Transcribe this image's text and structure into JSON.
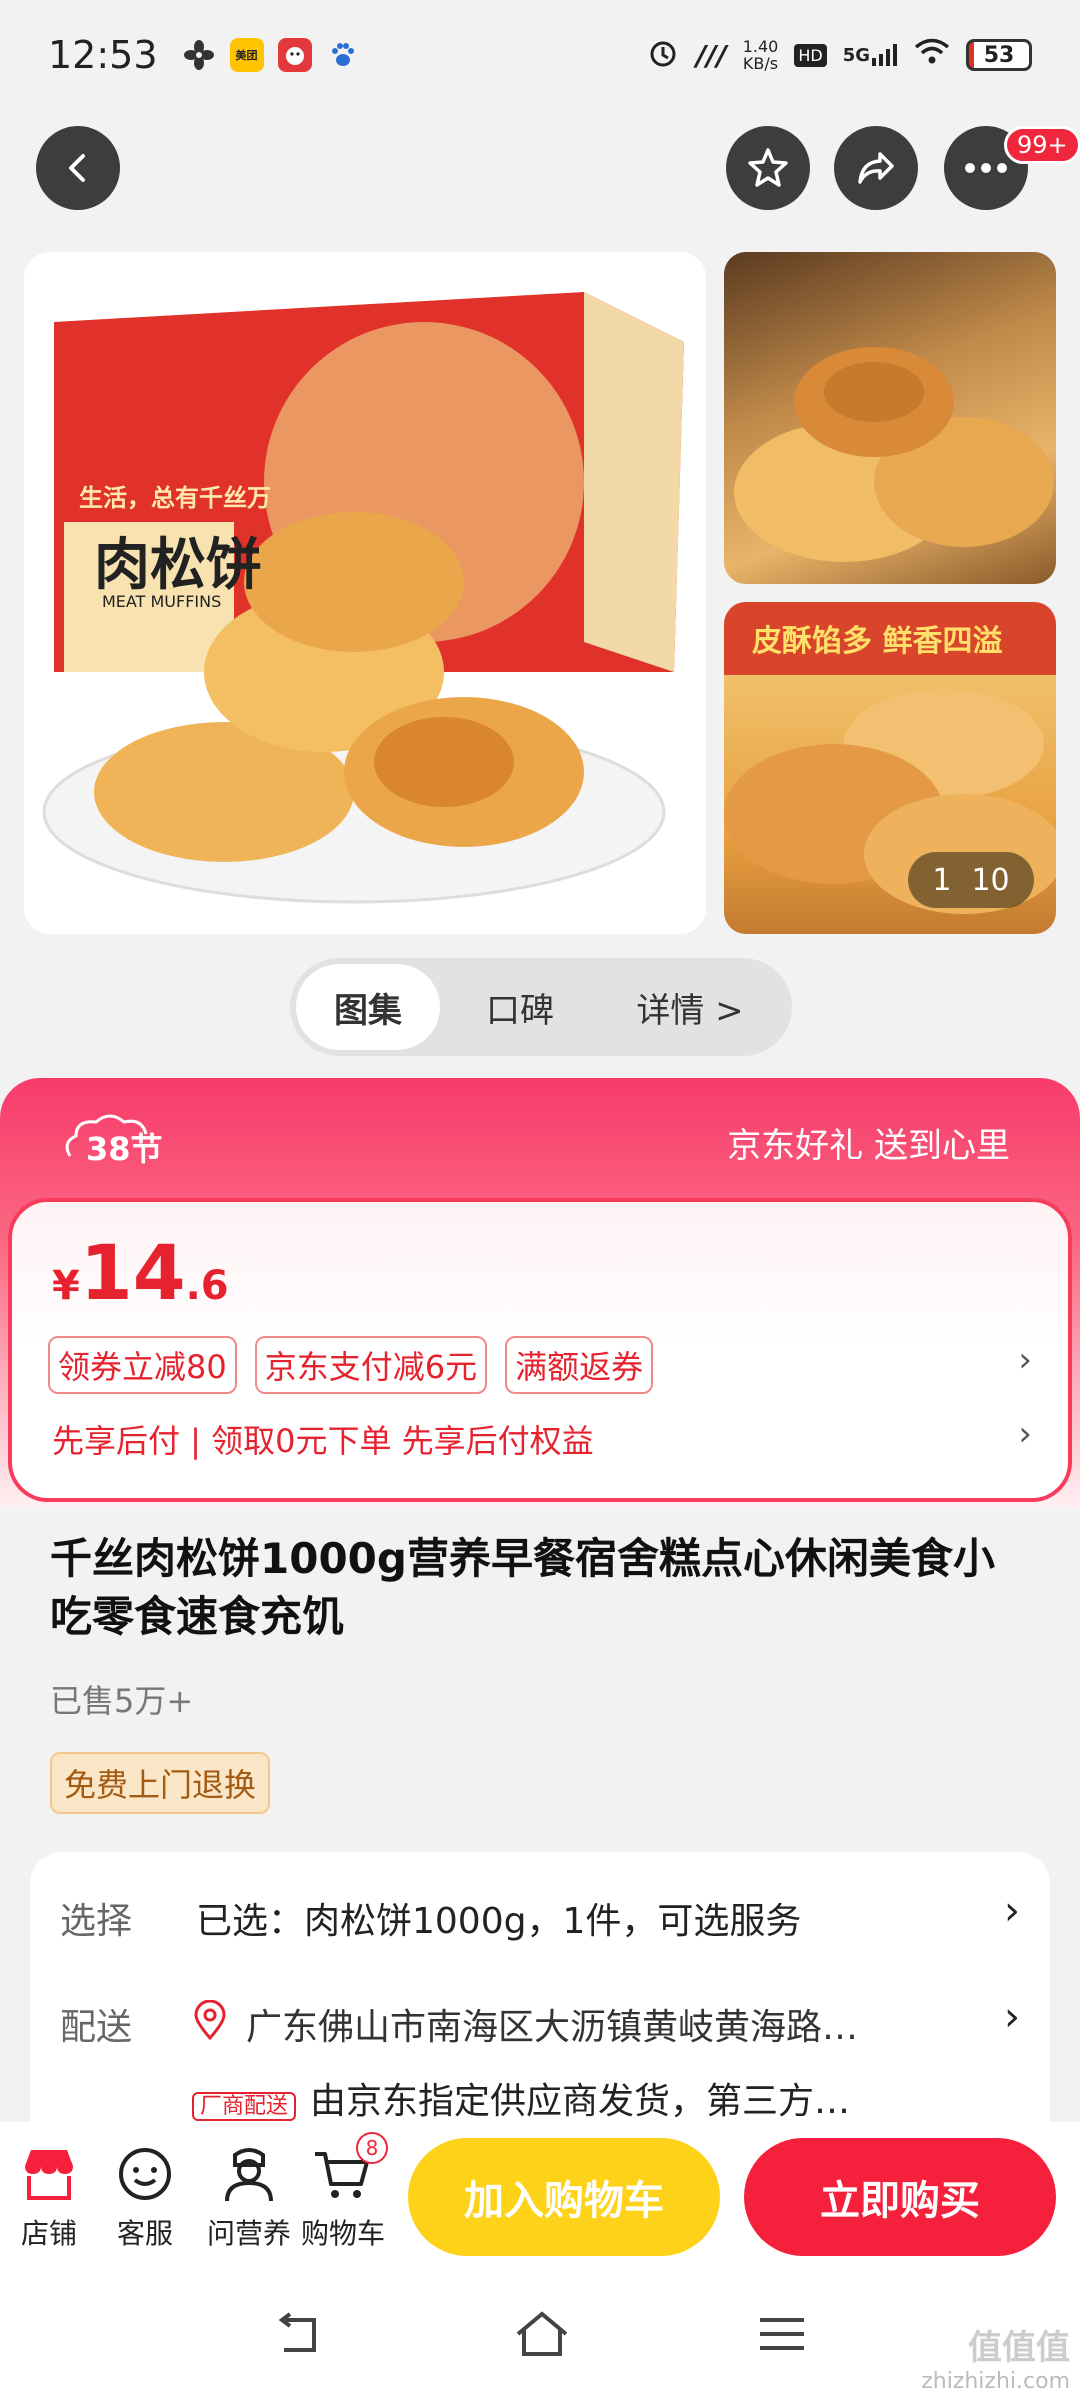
{
  "status_bar": {
    "time": "12:53",
    "app_icons": [
      "windmill-icon",
      "meituan-icon",
      "jd-icon",
      "paw-icon"
    ],
    "meituan_label": "美团",
    "net_speed_value": "1.40",
    "net_speed_unit": "KB/s",
    "hd": "HD",
    "network": "5G",
    "battery": "53"
  },
  "nav": {
    "more_badge": "99+"
  },
  "gallery": {
    "counter_current": "1",
    "counter_total": "10",
    "main_image_text": "肉松饼",
    "main_image_sub": "MEAT MUFFINS",
    "slogan": "生活，总有千丝万",
    "side_banner": "皮酥馅多 鲜香四溢"
  },
  "tabs": [
    {
      "label": "图集",
      "active": true
    },
    {
      "label": "口碑",
      "active": false
    },
    {
      "label": "详情 >",
      "active": false
    }
  ],
  "promo": {
    "festival": "38节",
    "slogan": "京东好礼 送到心里",
    "price_symbol": "¥",
    "price_int": "14",
    "price_dec": ".6",
    "coupons": [
      "领券立减80",
      "京东支付减6元",
      "满额返券"
    ],
    "pay_later": "先享后付 | 领取0元下单 先享后付权益"
  },
  "product": {
    "title": "千丝肉松饼1000g营养早餐宿舍糕点心休闲美食小吃零食速食充饥",
    "sold": "已售5万+",
    "service_tag": "免费上门退换"
  },
  "options": {
    "select_label": "选择",
    "select_value": "已选：肉松饼1000g，1件，可选服务",
    "delivery_label": "配送",
    "delivery_address": "广东佛山市南海区大沥镇黄岐黄海路…",
    "delivery_tag": "厂商配送",
    "delivery_note": "由京东指定供应商发货，第三方…"
  },
  "bottom_bar": {
    "items": [
      {
        "label": "店铺",
        "icon": "store-icon"
      },
      {
        "label": "客服",
        "icon": "chat-icon"
      },
      {
        "label": "问营养",
        "icon": "nutritionist-icon"
      },
      {
        "label": "购物车",
        "icon": "cart-icon"
      }
    ],
    "cart_count": "8",
    "add_to_cart": "加入购物车",
    "buy_now": "立即购买"
  },
  "watermark": {
    "line1": "值值值",
    "line2": "zhizhizhi.com"
  },
  "colors": {
    "accent": "#f5203c",
    "cart_button": "#ffd21a",
    "price": "#e6222e"
  }
}
